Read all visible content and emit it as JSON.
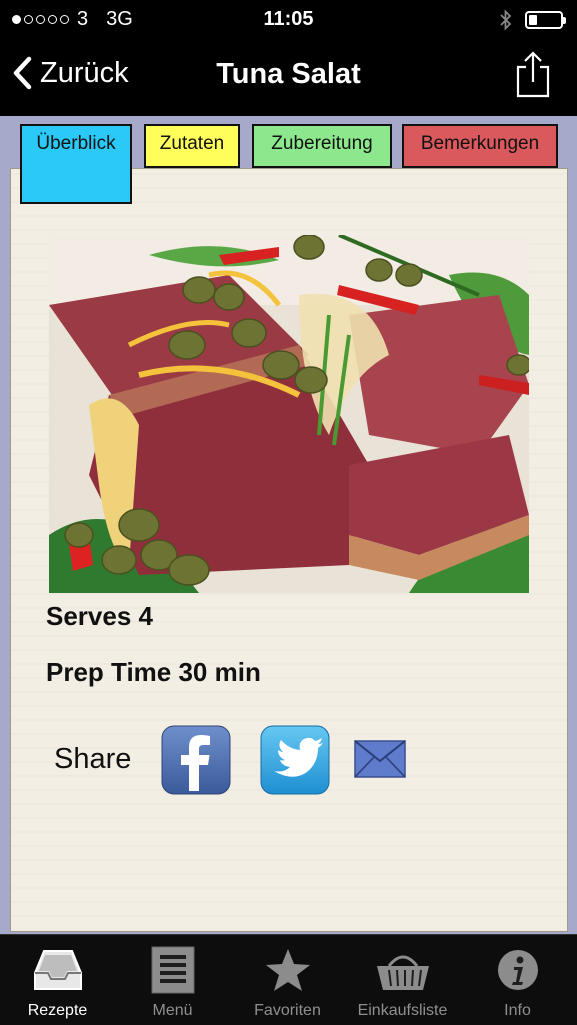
{
  "status_bar": {
    "carrier": "3",
    "network": "3G",
    "time": "11:05",
    "signal_bars": 1,
    "battery_level": 0.25
  },
  "nav": {
    "back_label": "Zurück",
    "title": "Tuna Salat",
    "share_icon": "share-icon"
  },
  "tabs": [
    {
      "label": "Überblick",
      "color": "#2ac9f7",
      "active": true
    },
    {
      "label": "Zutaten",
      "color": "#ffff5c",
      "active": false
    },
    {
      "label": "Zubereitung",
      "color": "#8de88d",
      "active": false
    },
    {
      "label": "Bemerkungen",
      "color": "#d9595c",
      "active": false
    }
  ],
  "recipe": {
    "serves": "Serves 4",
    "prep_time": "Prep Time 30 min",
    "share_label": "Share",
    "share_targets": [
      "facebook-icon",
      "twitter-icon",
      "mail-icon"
    ]
  },
  "tab_bar": [
    {
      "label": "Rezepte",
      "icon": "inbox-tray-icon",
      "active": true
    },
    {
      "label": "Menü",
      "icon": "list-icon",
      "active": false
    },
    {
      "label": "Favoriten",
      "icon": "star-icon",
      "active": false
    },
    {
      "label": "Einkaufsliste",
      "icon": "basket-icon",
      "active": false
    },
    {
      "label": "Info",
      "icon": "info-icon",
      "active": false
    }
  ]
}
